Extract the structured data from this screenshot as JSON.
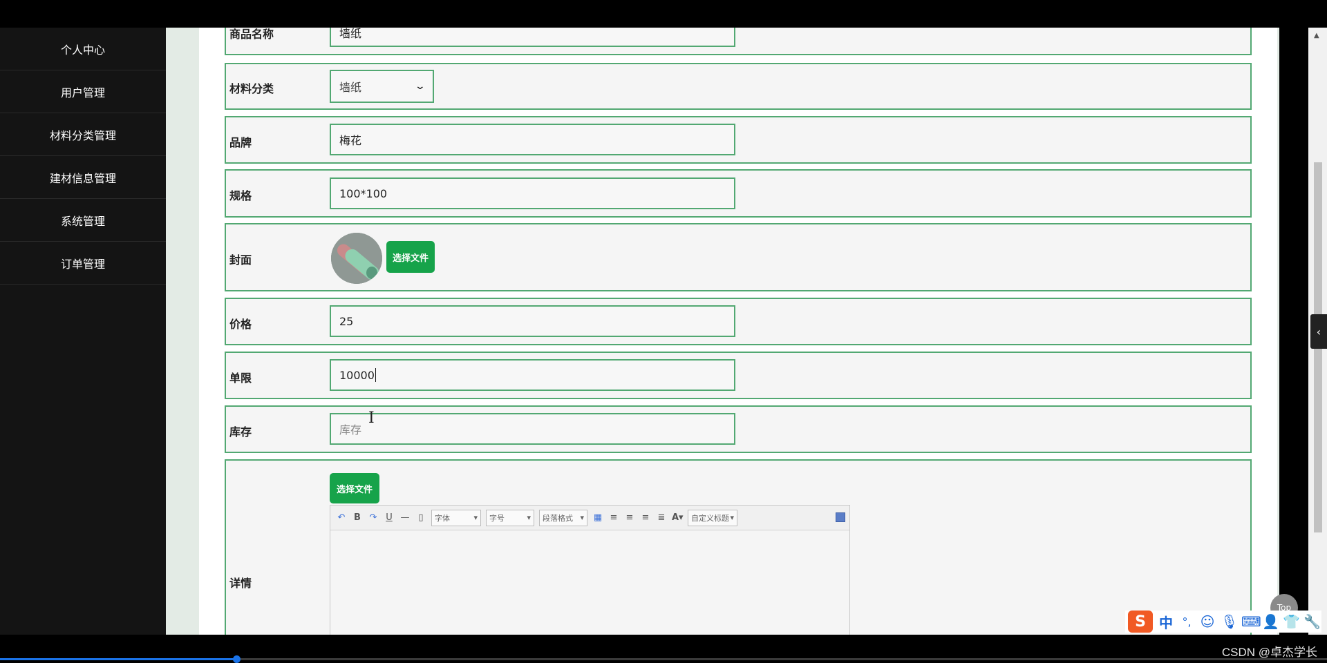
{
  "sidebar": {
    "items": [
      {
        "label": "个人中心"
      },
      {
        "label": "用户管理"
      },
      {
        "label": "材料分类管理"
      },
      {
        "label": "建材信息管理"
      },
      {
        "label": "系统管理"
      },
      {
        "label": "订单管理"
      }
    ]
  },
  "form": {
    "name": {
      "label": "商品名称",
      "value": "墙纸"
    },
    "category": {
      "label": "材料分类",
      "value": "墙纸"
    },
    "brand": {
      "label": "品牌",
      "value": "梅花"
    },
    "spec": {
      "label": "规格",
      "value": "100*100"
    },
    "cover": {
      "label": "封面",
      "button": "选择文件"
    },
    "price": {
      "label": "价格",
      "value": "25"
    },
    "limit": {
      "label": "单限",
      "value": "10000"
    },
    "stock": {
      "label": "库存",
      "value": "",
      "placeholder": "库存"
    },
    "detail": {
      "label": "详情",
      "button": "选择文件",
      "toolbar": {
        "font": "字体",
        "size": "字号",
        "paragraph": "段落格式",
        "custom_title": "自定义标题"
      }
    }
  },
  "top_button": "Top",
  "ime": {
    "mode": "中",
    "punct": "°,"
  },
  "watermark": "CSDN @卓杰学长",
  "video_progress": 0.178,
  "colors": {
    "accent": "#16a34a",
    "border": "#52a872",
    "sidebar": "#141414"
  }
}
